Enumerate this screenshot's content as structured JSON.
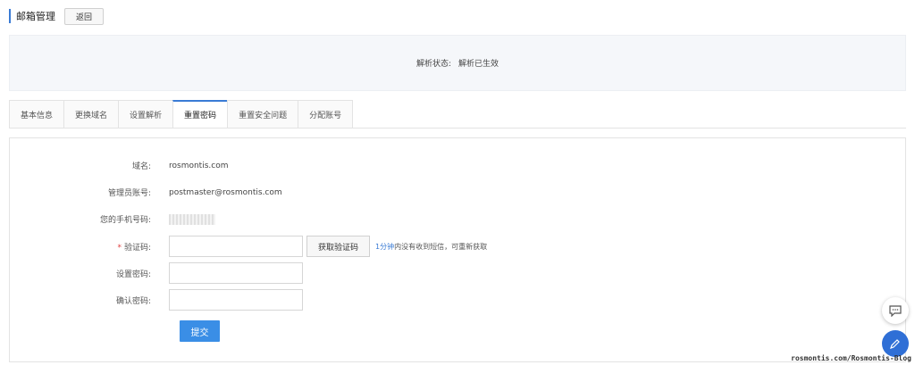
{
  "header": {
    "title": "邮箱管理",
    "back_label": "返回"
  },
  "status": {
    "label": "解析状态:",
    "value": "解析已生效"
  },
  "tabs": [
    {
      "label": "基本信息",
      "active": false
    },
    {
      "label": "更换域名",
      "active": false
    },
    {
      "label": "设置解析",
      "active": false
    },
    {
      "label": "重置密码",
      "active": true
    },
    {
      "label": "重置安全问题",
      "active": false
    },
    {
      "label": "分配账号",
      "active": false
    }
  ],
  "form": {
    "domain_label": "域名:",
    "domain_value": "rosmontis.com",
    "admin_label": "管理员账号:",
    "admin_value": "postmaster@rosmontis.com",
    "phone_label": "您的手机号码:",
    "code_required": "*",
    "code_label": "验证码:",
    "code_value": "",
    "get_code_label": "获取验证码",
    "hint_prefix": "1分钟",
    "hint_text": "内没有收到短信，可重新获取",
    "password_label": "设置密码:",
    "password_value": "",
    "confirm_label": "确认密码:",
    "confirm_value": "",
    "submit_label": "提交"
  },
  "watermark": "rosmontis.com/Rosmontis-Blog",
  "colors": {
    "accent": "#3a7bd5",
    "submit": "#3a8ee6"
  }
}
